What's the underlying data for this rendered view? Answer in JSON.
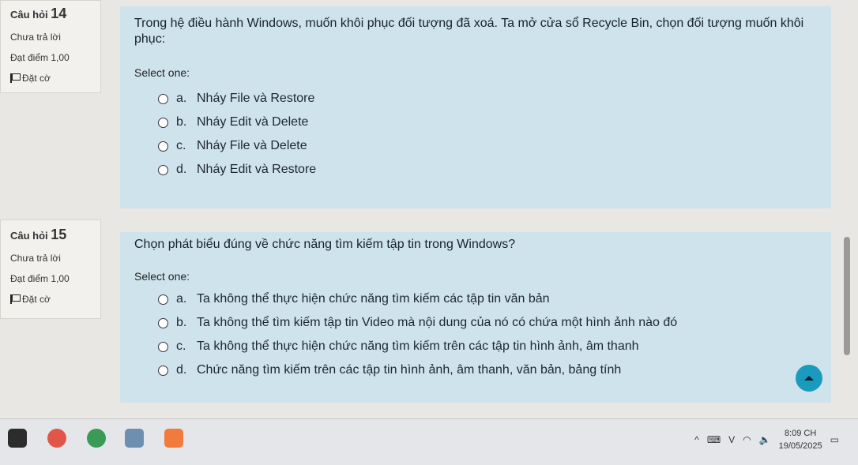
{
  "questions": [
    {
      "number_label": "Câu hỏi",
      "number": "14",
      "status": "Chưa trả lời",
      "score": "Đạt điểm 1,00",
      "flag": "Đặt cờ",
      "text": "Trong hệ điều hành Windows, muốn khôi phục đối tượng đã xoá. Ta mở cửa sổ Recycle Bin, chọn đối tượng muốn khôi phục:",
      "select_label": "Select one:",
      "options": [
        {
          "letter": "a.",
          "text": "Nháy File và Restore"
        },
        {
          "letter": "b.",
          "text": "Nháy Edit và Delete"
        },
        {
          "letter": "c.",
          "text": "Nháy File và Delete"
        },
        {
          "letter": "d.",
          "text": "Nháy Edit và Restore"
        }
      ]
    },
    {
      "number_label": "Câu hỏi",
      "number": "15",
      "status": "Chưa trả lời",
      "score": "Đạt điểm 1,00",
      "flag": "Đặt cờ",
      "text": "Chọn phát biểu đúng về chức năng tìm kiếm tập tin trong Windows?",
      "select_label": "Select one:",
      "options": [
        {
          "letter": "a.",
          "text": "Ta không thể thực hiện chức năng tìm kiếm các tập tin văn bản"
        },
        {
          "letter": "b.",
          "text": "Ta không thể tìm kiếm tập tin Video mà nội dung của nó có chứa một hình ảnh nào đó"
        },
        {
          "letter": "c.",
          "text": "Ta không thể thực hiện chức năng tìm kiếm trên các tập tin hình ảnh, âm thanh"
        },
        {
          "letter": "d.",
          "text": "Chức năng tìm kiếm trên các tập tin hình ảnh, âm thanh, văn bản, bảng tính"
        }
      ]
    }
  ],
  "taskbar": {
    "time": "8:09 CH",
    "date": "19/05/2025",
    "language": "V"
  }
}
